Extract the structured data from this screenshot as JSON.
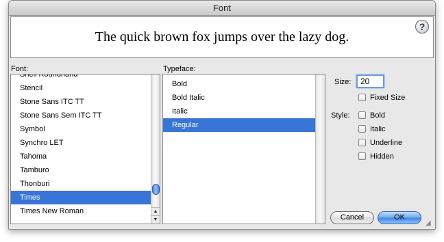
{
  "window": {
    "title": "Font"
  },
  "preview": {
    "text": "The quick brown fox jumps over the lazy dog."
  },
  "help": {
    "label": "?"
  },
  "font_list": {
    "label": "Font:",
    "items": [
      {
        "label": "Snell Roundhand",
        "selected": false
      },
      {
        "label": "Stencil",
        "selected": false
      },
      {
        "label": "Stone Sans ITC TT",
        "selected": false
      },
      {
        "label": "Stone Sans Sem ITC TT",
        "selected": false
      },
      {
        "label": "Symbol",
        "selected": false
      },
      {
        "label": "Synchro LET",
        "selected": false
      },
      {
        "label": "Tahoma",
        "selected": false
      },
      {
        "label": "Tamburo",
        "selected": false
      },
      {
        "label": "Thonburi",
        "selected": false
      },
      {
        "label": "Times",
        "selected": true
      },
      {
        "label": "Times New Roman",
        "selected": false
      }
    ]
  },
  "typeface_list": {
    "label": "Typeface:",
    "items": [
      {
        "label": "Bold",
        "selected": false
      },
      {
        "label": "Bold Italic",
        "selected": false
      },
      {
        "label": "Italic",
        "selected": false
      },
      {
        "label": "Regular",
        "selected": true
      }
    ]
  },
  "size": {
    "label": "Size:",
    "value": "20"
  },
  "fixed_size": {
    "label": "Fixed Size",
    "checked": false
  },
  "style": {
    "label": "Style:",
    "options": [
      {
        "label": "Bold",
        "checked": false
      },
      {
        "label": "Italic",
        "checked": false
      },
      {
        "label": "Underline",
        "checked": false
      },
      {
        "label": "Hidden",
        "checked": false
      }
    ]
  },
  "buttons": {
    "cancel": "Cancel",
    "ok": "OK"
  },
  "colors": {
    "selection": "#3875d7",
    "default_button": "#3d86e4"
  }
}
